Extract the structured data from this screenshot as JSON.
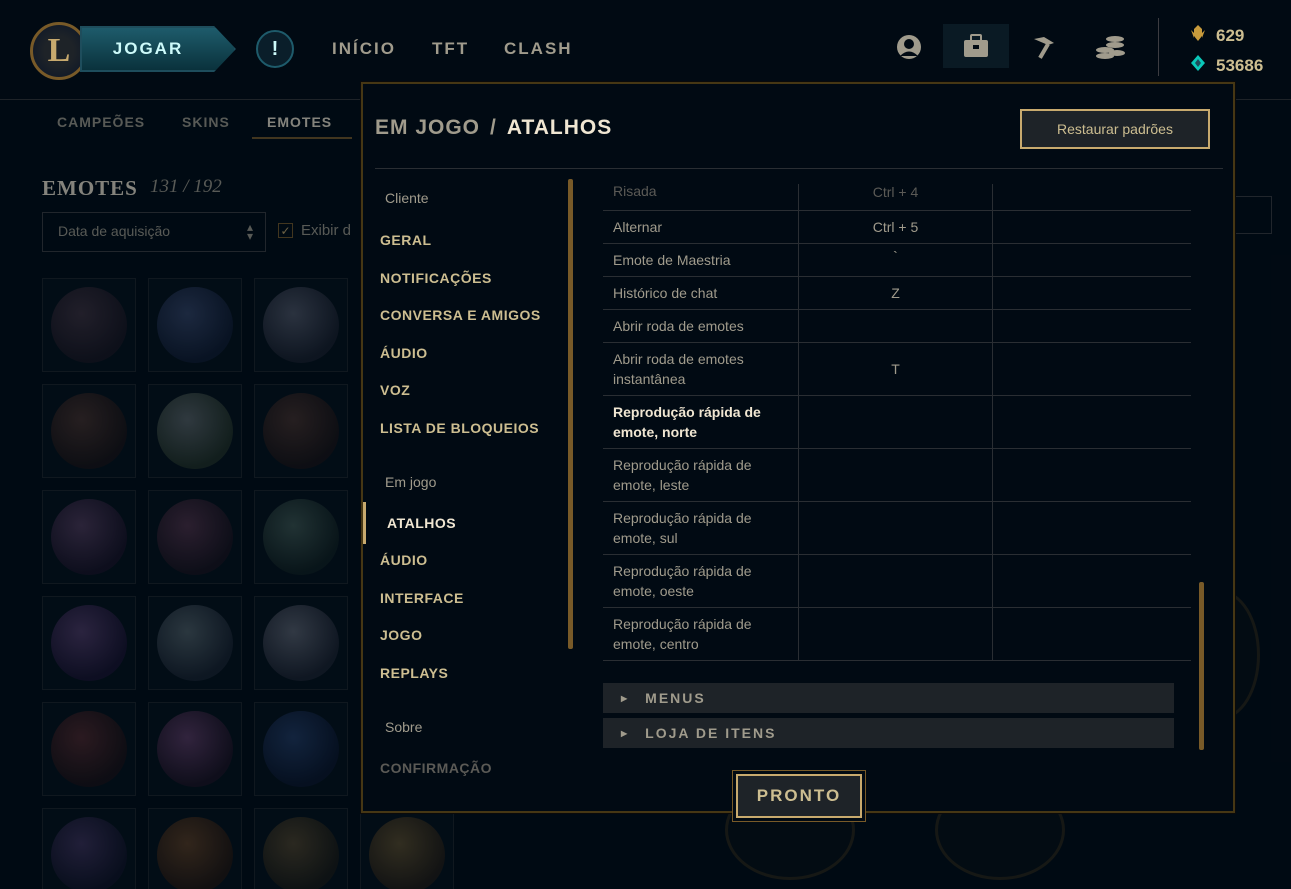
{
  "topbar": {
    "logo_letter": "L",
    "play_label": "JOGAR",
    "alert_glyph": "!",
    "tabs": [
      "INÍCIO",
      "TFT",
      "CLASH"
    ],
    "icons": [
      "profile-icon",
      "collection-icon",
      "crafting-icon",
      "store-icon"
    ],
    "currency": [
      {
        "icon": "blue-essence-icon",
        "value": "629"
      },
      {
        "icon": "riot-points-icon",
        "value": "53686"
      }
    ]
  },
  "collection": {
    "subtabs": [
      "CAMPEÕES",
      "SKINS",
      "EMOTES"
    ],
    "title": "EMOTES",
    "count": "131 / 192",
    "sort_value": "Data de aquisição",
    "show_label": "Exibir d"
  },
  "modal": {
    "heading_parent": "EM JOGO",
    "heading_sep": "/",
    "heading_current": "ATALHOS",
    "restore_label": "Restaurar padrões",
    "done_label": "PRONTO",
    "nav": {
      "client_group": "Cliente",
      "client_items": [
        "GERAL",
        "NOTIFICAÇÕES",
        "CONVERSA E AMIGOS",
        "ÁUDIO",
        "VOZ",
        "LISTA DE BLOQUEIOS"
      ],
      "game_group": "Em jogo",
      "game_items": [
        "ATALHOS",
        "ÁUDIO",
        "INTERFACE",
        "JOGO",
        "REPLAYS"
      ],
      "about_group": "Sobre",
      "about_items": [
        "CONFIRMAÇÃO"
      ]
    },
    "shortcuts": [
      {
        "action": "Risada",
        "key": "Ctrl + 4",
        "alt": ""
      },
      {
        "action": "Alternar",
        "key": "Ctrl + 5",
        "alt": ""
      },
      {
        "action": "Emote de Maestria",
        "key": "`",
        "alt": ""
      },
      {
        "action": "Histórico de chat",
        "key": "Z",
        "alt": ""
      },
      {
        "action": "Abrir roda de emotes",
        "key": "",
        "alt": ""
      },
      {
        "action": "Abrir roda de emotes instantânea",
        "key": "T",
        "alt": ""
      },
      {
        "action": "Reprodução rápida de emote, norte",
        "key": "",
        "alt": ""
      },
      {
        "action": "Reprodução rápida de emote, leste",
        "key": "",
        "alt": ""
      },
      {
        "action": "Reprodução rápida de emote, sul",
        "key": "",
        "alt": ""
      },
      {
        "action": "Reprodução rápida de emote, oeste",
        "key": "",
        "alt": ""
      },
      {
        "action": "Reprodução rápida de emote, centro",
        "key": "",
        "alt": ""
      }
    ],
    "sections": [
      "MENUS",
      "LOJA DE ITENS"
    ]
  }
}
